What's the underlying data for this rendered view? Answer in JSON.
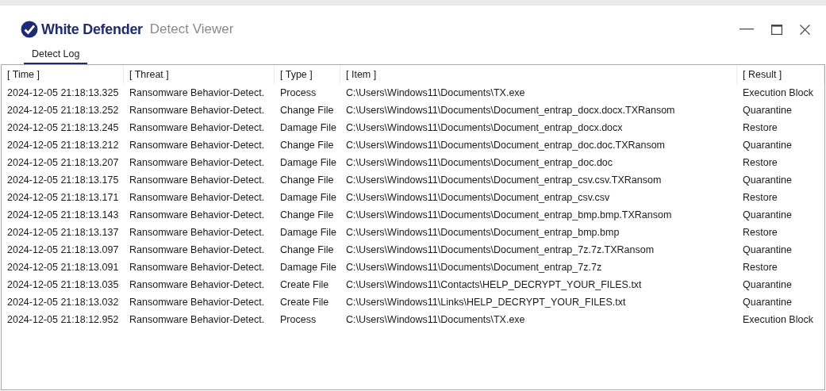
{
  "window": {
    "brand": "White Defender",
    "title": "Detect Viewer"
  },
  "tabs": [
    {
      "label": "Detect Log",
      "selected": true
    }
  ],
  "table": {
    "columns": [
      "[ Time ]",
      "[ Threat ]",
      "[ Type ]",
      "[ Item ]",
      "[ Result ]"
    ],
    "rows": [
      [
        "2024-12-05 21:18:13.325",
        "Ransomware Behavior-Detect.",
        "Process",
        "C:\\Users\\Windows11\\Documents\\TX.exe",
        "Execution Block"
      ],
      [
        "2024-12-05 21:18:13.252",
        "Ransomware Behavior-Detect.",
        "Change File",
        "C:\\Users\\Windows11\\Documents\\Document_entrap_docx.docx.TXRansom",
        "Quarantine"
      ],
      [
        "2024-12-05 21:18:13.245",
        "Ransomware Behavior-Detect.",
        "Damage File",
        "C:\\Users\\Windows11\\Documents\\Document_entrap_docx.docx",
        "Restore"
      ],
      [
        "2024-12-05 21:18:13.212",
        "Ransomware Behavior-Detect.",
        "Change File",
        "C:\\Users\\Windows11\\Documents\\Document_entrap_doc.doc.TXRansom",
        "Quarantine"
      ],
      [
        "2024-12-05 21:18:13.207",
        "Ransomware Behavior-Detect.",
        "Damage File",
        "C:\\Users\\Windows11\\Documents\\Document_entrap_doc.doc",
        "Restore"
      ],
      [
        "2024-12-05 21:18:13.175",
        "Ransomware Behavior-Detect.",
        "Change File",
        "C:\\Users\\Windows11\\Documents\\Document_entrap_csv.csv.TXRansom",
        "Quarantine"
      ],
      [
        "2024-12-05 21:18:13.171",
        "Ransomware Behavior-Detect.",
        "Damage File",
        "C:\\Users\\Windows11\\Documents\\Document_entrap_csv.csv",
        "Restore"
      ],
      [
        "2024-12-05 21:18:13.143",
        "Ransomware Behavior-Detect.",
        "Change File",
        "C:\\Users\\Windows11\\Documents\\Document_entrap_bmp.bmp.TXRansom",
        "Quarantine"
      ],
      [
        "2024-12-05 21:18:13.137",
        "Ransomware Behavior-Detect.",
        "Damage File",
        "C:\\Users\\Windows11\\Documents\\Document_entrap_bmp.bmp",
        "Restore"
      ],
      [
        "2024-12-05 21:18:13.097",
        "Ransomware Behavior-Detect.",
        "Change File",
        "C:\\Users\\Windows11\\Documents\\Document_entrap_7z.7z.TXRansom",
        "Quarantine"
      ],
      [
        "2024-12-05 21:18:13.091",
        "Ransomware Behavior-Detect.",
        "Damage File",
        "C:\\Users\\Windows11\\Documents\\Document_entrap_7z.7z",
        "Restore"
      ],
      [
        "2024-12-05 21:18:13.035",
        "Ransomware Behavior-Detect.",
        "Create File",
        "C:\\Users\\Windows11\\Contacts\\HELP_DECRYPT_YOUR_FILES.txt",
        "Quarantine"
      ],
      [
        "2024-12-05 21:18:13.032",
        "Ransomware Behavior-Detect.",
        "Create File",
        "C:\\Users\\Windows11\\Links\\HELP_DECRYPT_YOUR_FILES.txt",
        "Quarantine"
      ],
      [
        "2024-12-05 21:18:12.952",
        "Ransomware Behavior-Detect.",
        "Process",
        "C:\\Users\\Windows11\\Documents\\TX.exe",
        "Execution Block"
      ]
    ]
  }
}
